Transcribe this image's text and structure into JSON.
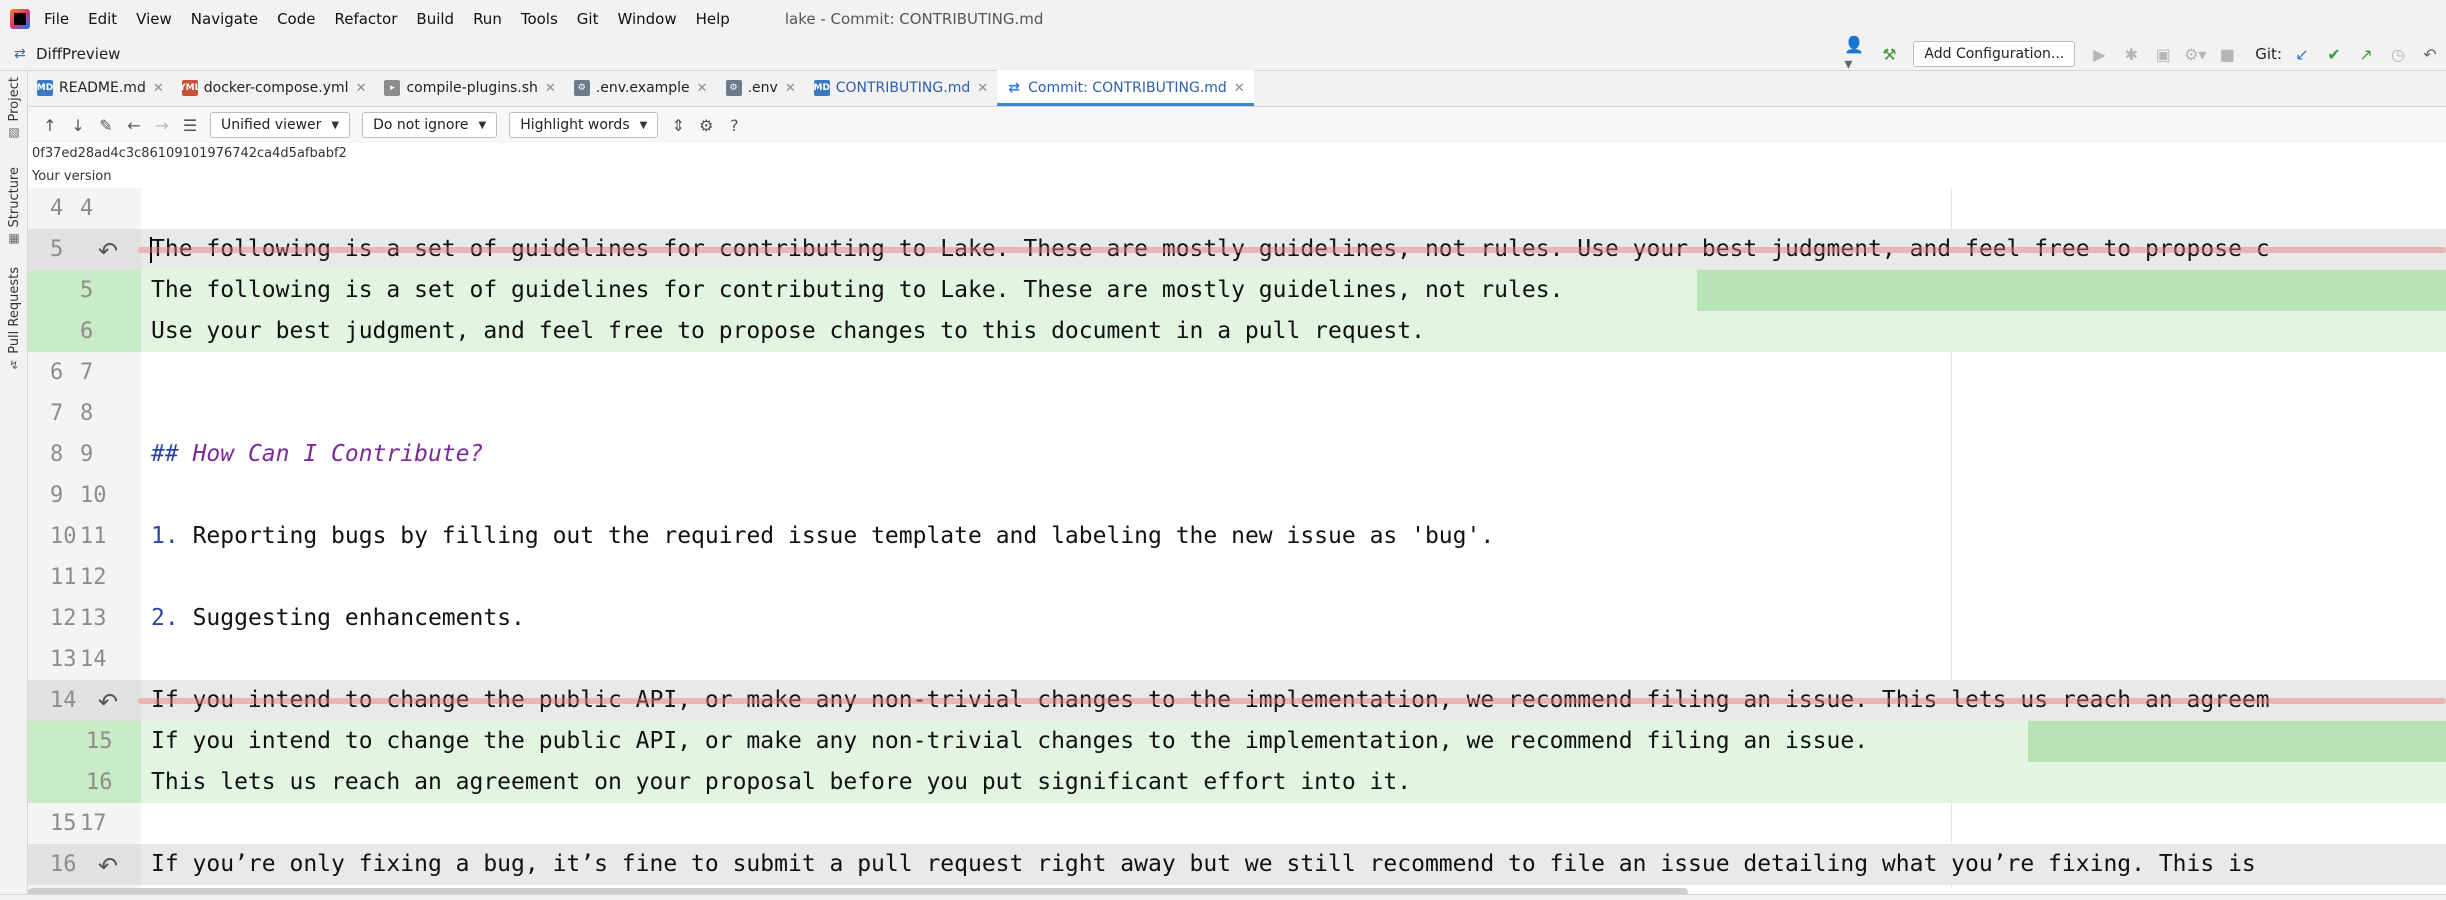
{
  "menubar": {
    "items": [
      "File",
      "Edit",
      "View",
      "Navigate",
      "Code",
      "Refactor",
      "Build",
      "Run",
      "Tools",
      "Git",
      "Window",
      "Help"
    ],
    "title": "lake - Commit: CONTRIBUTING.md"
  },
  "navbar": {
    "diff_label": "DiffPreview",
    "add_config": "Add Configuration...",
    "git_label": "Git:"
  },
  "toolstrip": {
    "project": "Project",
    "structure": "Structure",
    "pull_requests": "Pull Requests"
  },
  "tabs": [
    {
      "label": "README.md",
      "icon": "md"
    },
    {
      "label": "docker-compose.yml",
      "icon": "yml"
    },
    {
      "label": "compile-plugins.sh",
      "icon": "sh"
    },
    {
      "label": ".env.example",
      "icon": "env"
    },
    {
      "label": ".env",
      "icon": "env"
    },
    {
      "label": "CONTRIBUTING.md",
      "icon": "md"
    },
    {
      "label": "Commit: CONTRIBUTING.md",
      "icon": "commit",
      "active": true
    }
  ],
  "difftoolbar": {
    "viewer": "Unified viewer",
    "ignore": "Do not ignore",
    "highlight": "Highlight words",
    "help": "?"
  },
  "commit_hash": "0f37ed28ad4c3c86109101976742ca4d5afbabf2",
  "version_label": "Your version",
  "lines": [
    {
      "l": "4",
      "r": "4",
      "type": "ctx",
      "text": ""
    },
    {
      "l": "5",
      "r": "",
      "type": "del",
      "text": "The following is a set of guidelines for contributing to Lake. These are mostly guidelines, not rules. Use your best judgment, and feel free to propose c"
    },
    {
      "l": "",
      "r": "5",
      "type": "add",
      "text": "The following is a set of guidelines for contributing to Lake. These are mostly guidelines, not rules."
    },
    {
      "l": "",
      "r": "6",
      "type": "add",
      "text": "Use your best judgment, and feel free to propose changes to this document in a pull request."
    },
    {
      "l": "6",
      "r": "7",
      "type": "ctx",
      "text": ""
    },
    {
      "l": "7",
      "r": "8",
      "type": "ctx",
      "text": ""
    },
    {
      "l": "8",
      "r": "9",
      "type": "head",
      "hash": "##",
      "text": "How Can I Contribute?"
    },
    {
      "l": "9",
      "r": "10",
      "type": "ctx",
      "text": ""
    },
    {
      "l": "10",
      "r": "11",
      "type": "num",
      "num": "1.",
      "text": "Reporting bugs by filling out the required issue template and labeling the new issue as 'bug'."
    },
    {
      "l": "11",
      "r": "12",
      "type": "ctx",
      "text": ""
    },
    {
      "l": "12",
      "r": "13",
      "type": "num",
      "num": "2.",
      "text": "Suggesting enhancements."
    },
    {
      "l": "13",
      "r": "14",
      "type": "ctx",
      "text": ""
    },
    {
      "l": "14",
      "r": "",
      "type": "del",
      "text": "If you intend to change the public API, or make any non-trivial changes to the implementation, we recommend filing an issue. This lets us reach an agreem"
    },
    {
      "l": "",
      "r": "15",
      "type": "add",
      "text": "If you intend to change the public API, or make any non-trivial changes to the implementation, we recommend filing an issue."
    },
    {
      "l": "",
      "r": "16",
      "type": "add",
      "text": "This lets us reach an agreement on your proposal before you put significant effort into it."
    },
    {
      "l": "15",
      "r": "17",
      "type": "ctx",
      "text": ""
    },
    {
      "l": "16",
      "r": "",
      "type": "del",
      "text": "If you’re only fixing a bug, it’s fine to submit a pull request right away but we still recommend to file an issue detailing what you’re fixing. This is"
    }
  ],
  "colors": {
    "added_bg": "#e2f5e0",
    "added_word": "#b8e4b5",
    "deleted_bg": "#e9e9e9",
    "accent": "#4083c9"
  }
}
